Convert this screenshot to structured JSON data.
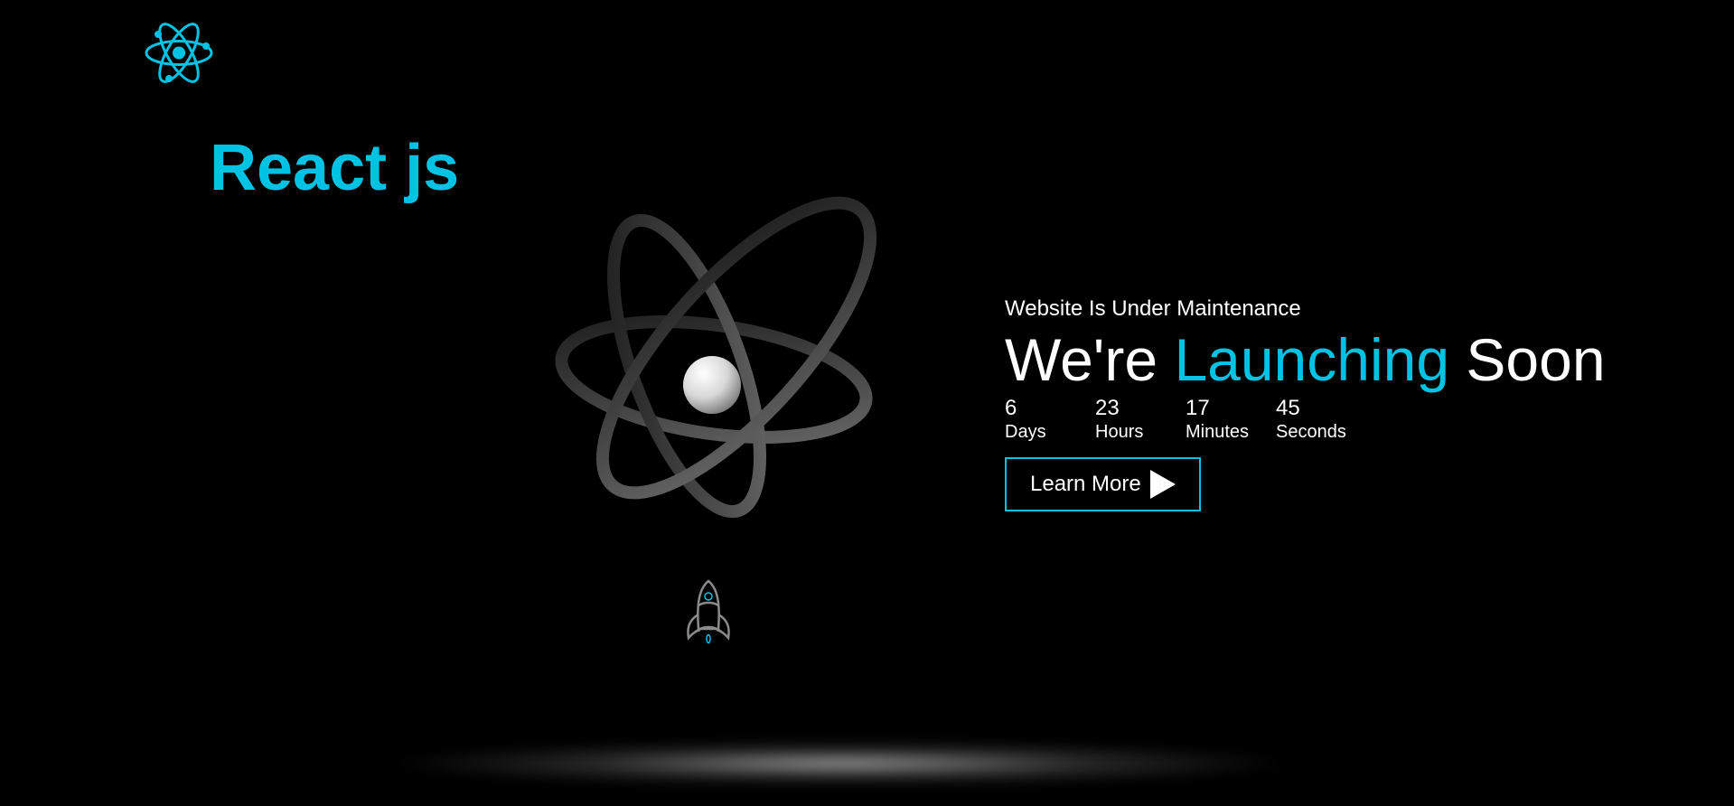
{
  "brand": {
    "title": "React js",
    "logo_icon": "react-atom-icon"
  },
  "hero": {
    "illustration_icon": "atom-icon",
    "rocket_icon": "rocket-icon"
  },
  "maintenance": {
    "subtitle": "Website Is Under Maintenance",
    "headline_part1": "We're ",
    "headline_accent": "Launching",
    "headline_part2": " Soon"
  },
  "countdown": [
    {
      "value": "6",
      "label": "Days"
    },
    {
      "value": "23",
      "label": "Hours"
    },
    {
      "value": "17",
      "label": "Minutes"
    },
    {
      "value": "45",
      "label": "Seconds"
    }
  ],
  "cta": {
    "label": "Learn More",
    "icon": "play-icon"
  },
  "colors": {
    "accent": "#00c3e3",
    "background": "#000000",
    "text": "#ffffff"
  }
}
